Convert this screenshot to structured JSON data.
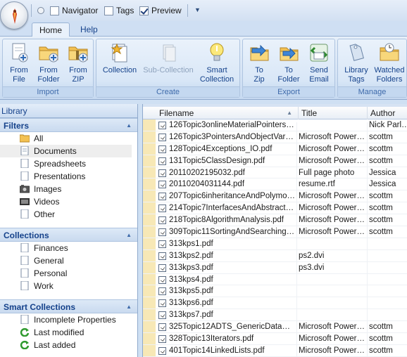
{
  "qat": {
    "items": [
      {
        "label": "Navigator",
        "checked": false
      },
      {
        "label": "Tags",
        "checked": false
      },
      {
        "label": "Preview",
        "checked": true
      }
    ]
  },
  "tabs": [
    {
      "label": "Home",
      "active": true
    },
    {
      "label": "Help",
      "active": false
    }
  ],
  "ribbon": {
    "groups": [
      {
        "label": "Import",
        "buttons": [
          {
            "label": "From File",
            "icon": "from-file-icon"
          },
          {
            "label": "From Folder",
            "icon": "from-folder-icon"
          },
          {
            "label": "From ZIP",
            "icon": "from-zip-icon"
          }
        ]
      },
      {
        "label": "Create",
        "buttons": [
          {
            "label": "Collection",
            "icon": "collection-icon"
          },
          {
            "label": "Sub-Collection",
            "icon": "sub-collection-icon",
            "disabled": true
          },
          {
            "label": "Smart Collection",
            "icon": "smart-collection-icon"
          }
        ]
      },
      {
        "label": "Export",
        "buttons": [
          {
            "label": "To Zip",
            "icon": "to-zip-icon"
          },
          {
            "label": "To Folder",
            "icon": "to-folder-icon"
          },
          {
            "label": "Send Email",
            "icon": "send-email-icon"
          }
        ]
      },
      {
        "label": "Manage",
        "buttons": [
          {
            "label": "Library Tags",
            "icon": "library-tags-icon"
          },
          {
            "label": "Watched Folders",
            "icon": "watched-folders-icon"
          }
        ]
      }
    ]
  },
  "library": {
    "header": "Library",
    "filters": {
      "title": "Filters",
      "items": [
        {
          "label": "All",
          "icon": "folder-icon"
        },
        {
          "label": "Documents",
          "icon": "document-icon",
          "selected": true
        },
        {
          "label": "Spreadsheets",
          "icon": "spreadsheet-icon"
        },
        {
          "label": "Presentations",
          "icon": "presentation-icon"
        },
        {
          "label": "Images",
          "icon": "image-icon"
        },
        {
          "label": "Videos",
          "icon": "video-icon"
        },
        {
          "label": "Other",
          "icon": "other-icon"
        }
      ]
    },
    "collections": {
      "title": "Collections",
      "items": [
        {
          "label": "Finances"
        },
        {
          "label": "General"
        },
        {
          "label": "Personal"
        },
        {
          "label": "Work"
        }
      ]
    },
    "smart_collections": {
      "title": "Smart Collections",
      "items": [
        {
          "label": "Incomplete Properties",
          "icon": "document-icon"
        },
        {
          "label": "Last modified",
          "icon": "refresh-icon"
        },
        {
          "label": "Last added",
          "icon": "refresh-icon"
        }
      ]
    }
  },
  "file_list": {
    "columns": {
      "filename": "Filename",
      "title": "Title",
      "author": "Author"
    },
    "rows": [
      {
        "filename": "126Topic3onlineMaterialPointersAn...",
        "title": "",
        "author": "Nick Parlante"
      },
      {
        "filename": "126Topic3PointersAndObjectVaria...",
        "title": "Microsoft PowerP...",
        "author": "scottm"
      },
      {
        "filename": "128Topic4Exceptions_IO.pdf",
        "title": "Microsoft PowerP...",
        "author": "scottm"
      },
      {
        "filename": "131Topic5ClassDesign.pdf",
        "title": "Microsoft PowerP...",
        "author": "scottm"
      },
      {
        "filename": "20110202195032.pdf",
        "title": "Full page photo",
        "author": "Jessica"
      },
      {
        "filename": "20110204031144.pdf",
        "title": "resume.rtf",
        "author": "Jessica"
      },
      {
        "filename": "207Topic6inheritanceAndPolymorp...",
        "title": "Microsoft PowerP...",
        "author": "scottm"
      },
      {
        "filename": "214Topic7InterfacesAndAbstractCl...",
        "title": "Microsoft PowerP...",
        "author": "scottm"
      },
      {
        "filename": "218Topic8AlgorithmAnalysis.pdf",
        "title": "Microsoft PowerP...",
        "author": "scottm"
      },
      {
        "filename": "309Topic11SortingAndSearching.pdf",
        "title": "Microsoft PowerP...",
        "author": "scottm"
      },
      {
        "filename": "313kps1.pdf",
        "title": "",
        "author": ""
      },
      {
        "filename": "313kps2.pdf",
        "title": "ps2.dvi",
        "author": ""
      },
      {
        "filename": "313kps3.pdf",
        "title": "ps3.dvi",
        "author": ""
      },
      {
        "filename": "313kps4.pdf",
        "title": "",
        "author": ""
      },
      {
        "filename": "313kps5.pdf",
        "title": "",
        "author": ""
      },
      {
        "filename": "313kps6.pdf",
        "title": "",
        "author": ""
      },
      {
        "filename": "313kps7.pdf",
        "title": "",
        "author": ""
      },
      {
        "filename": "325Topic12ADTS_GenericDataStr...",
        "title": "Microsoft PowerP...",
        "author": "scottm"
      },
      {
        "filename": "328Topic13Iterators.pdf",
        "title": "Microsoft PowerP...",
        "author": "scottm"
      },
      {
        "filename": "401Topic14LinkedLists.pdf",
        "title": "Microsoft PowerP...",
        "author": "scottm"
      }
    ]
  }
}
